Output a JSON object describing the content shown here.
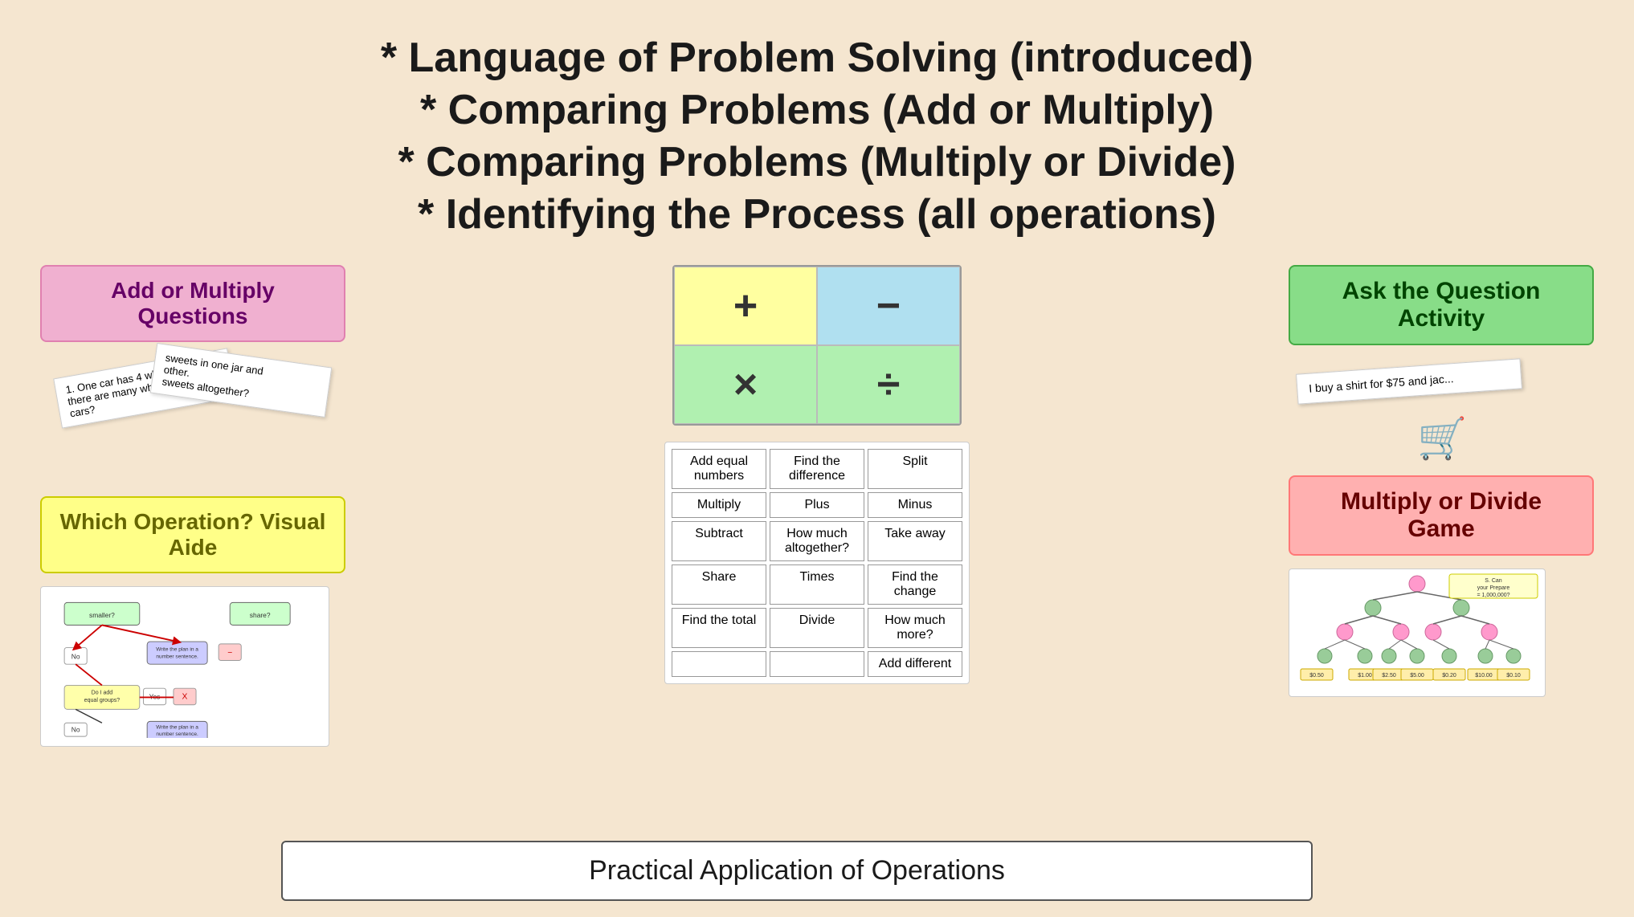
{
  "title": {
    "line1": "* Language of Problem Solving (introduced)",
    "line2": "* Comparing Problems (Add or Multiply)",
    "line3": "* Comparing Problems (Multiply or Divide)",
    "line4": "* Identifying the Process (all operations)"
  },
  "left": {
    "add_multiply_label": "Add or Multiply Questions",
    "which_operation_label": "Which Operation? Visual Aide"
  },
  "operations": {
    "plus": "+",
    "minus": "−",
    "times": "×",
    "divide": "÷"
  },
  "word_boxes": [
    "Add equal numbers",
    "Find the difference",
    "Split",
    "Multiply",
    "Plus",
    "Minus",
    "Subtract",
    "How much altogether?",
    "Take away",
    "Share",
    "Times",
    "Find the change",
    "Find the total",
    "Divide",
    "How much more?",
    "",
    "",
    "Add different"
  ],
  "right": {
    "ask_question_label": "Ask the Question Activity",
    "multiply_divide_label": "Multiply or Divide Game"
  },
  "paper_cards": {
    "card1_line1": "1. One car has 4 wheels.",
    "card1_line2": "there are",
    "card1_line3": "many wheels in all if",
    "card1_line4": "cars?",
    "card2_line1": "sweets in one jar and",
    "card2_line2": "other.",
    "card2_line3": "sweets altogether?"
  },
  "ask_paper": {
    "text": "I buy a shirt for $75 and jac..."
  },
  "practical": {
    "label": "Practical Application of Operations"
  }
}
